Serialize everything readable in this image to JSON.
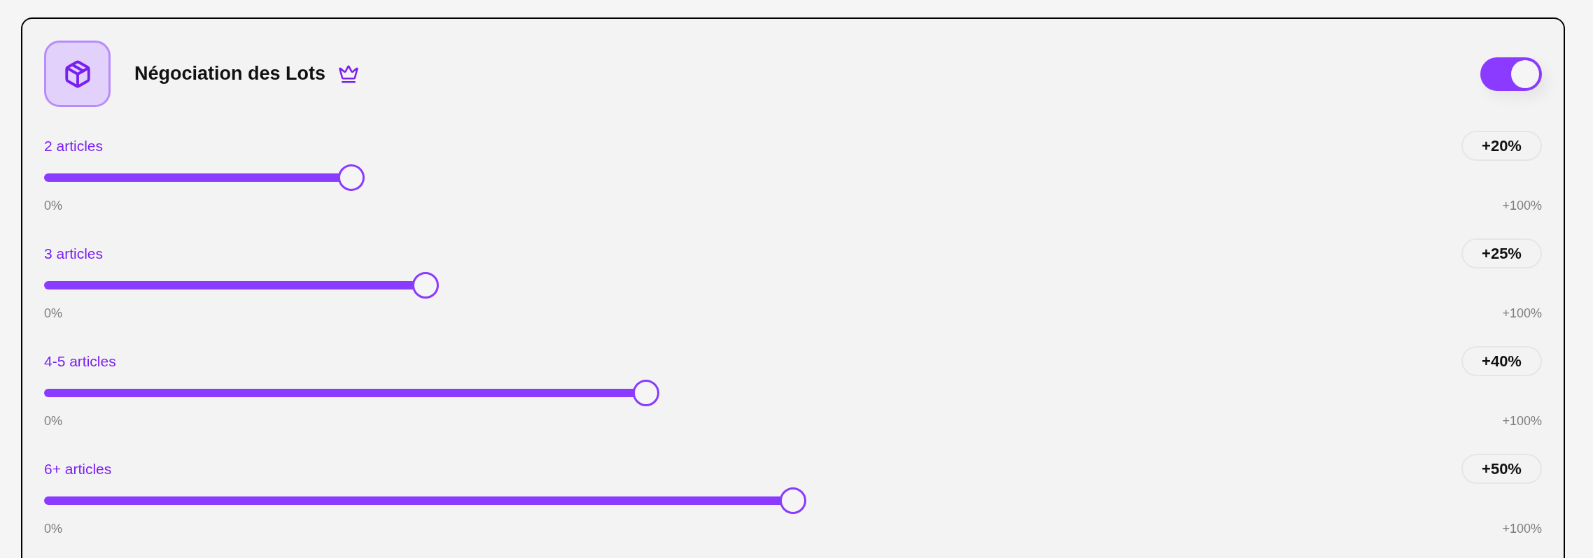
{
  "feature": {
    "title": "Négociation des Lots",
    "premium": true,
    "enabled": true
  },
  "tiers": [
    {
      "label": "2 articles",
      "value": "+20%",
      "level": 0.2,
      "min_label": "0%",
      "max_label": "+100%"
    },
    {
      "label": "3 articles",
      "value": "+25%",
      "level": 0.25,
      "min_label": "0%",
      "max_label": "+100%"
    },
    {
      "label": "4-5 articles",
      "value": "+40%",
      "level": 0.4,
      "min_label": "0%",
      "max_label": "+100%"
    },
    {
      "label": "6+ articles",
      "value": "+50%",
      "level": 0.5,
      "min_label": "0%",
      "max_label": "+100%"
    }
  ]
}
